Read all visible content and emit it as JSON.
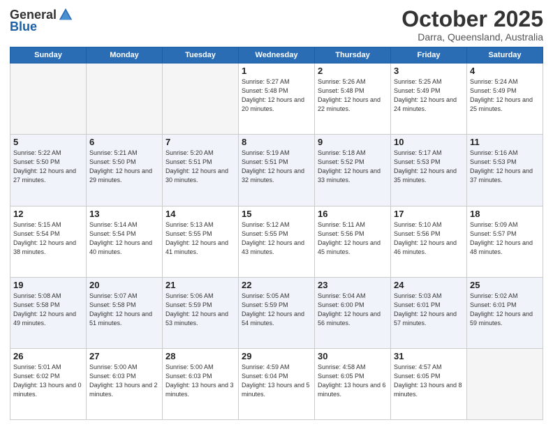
{
  "header": {
    "logo_general": "General",
    "logo_blue": "Blue",
    "month_title": "October 2025",
    "location": "Darra, Queensland, Australia"
  },
  "days_of_week": [
    "Sunday",
    "Monday",
    "Tuesday",
    "Wednesday",
    "Thursday",
    "Friday",
    "Saturday"
  ],
  "weeks": [
    [
      {
        "day": null,
        "info": null
      },
      {
        "day": null,
        "info": null
      },
      {
        "day": null,
        "info": null
      },
      {
        "day": "1",
        "info": "Sunrise: 5:27 AM\nSunset: 5:48 PM\nDaylight: 12 hours\nand 20 minutes."
      },
      {
        "day": "2",
        "info": "Sunrise: 5:26 AM\nSunset: 5:48 PM\nDaylight: 12 hours\nand 22 minutes."
      },
      {
        "day": "3",
        "info": "Sunrise: 5:25 AM\nSunset: 5:49 PM\nDaylight: 12 hours\nand 24 minutes."
      },
      {
        "day": "4",
        "info": "Sunrise: 5:24 AM\nSunset: 5:49 PM\nDaylight: 12 hours\nand 25 minutes."
      }
    ],
    [
      {
        "day": "5",
        "info": "Sunrise: 5:22 AM\nSunset: 5:50 PM\nDaylight: 12 hours\nand 27 minutes."
      },
      {
        "day": "6",
        "info": "Sunrise: 5:21 AM\nSunset: 5:50 PM\nDaylight: 12 hours\nand 29 minutes."
      },
      {
        "day": "7",
        "info": "Sunrise: 5:20 AM\nSunset: 5:51 PM\nDaylight: 12 hours\nand 30 minutes."
      },
      {
        "day": "8",
        "info": "Sunrise: 5:19 AM\nSunset: 5:51 PM\nDaylight: 12 hours\nand 32 minutes."
      },
      {
        "day": "9",
        "info": "Sunrise: 5:18 AM\nSunset: 5:52 PM\nDaylight: 12 hours\nand 33 minutes."
      },
      {
        "day": "10",
        "info": "Sunrise: 5:17 AM\nSunset: 5:53 PM\nDaylight: 12 hours\nand 35 minutes."
      },
      {
        "day": "11",
        "info": "Sunrise: 5:16 AM\nSunset: 5:53 PM\nDaylight: 12 hours\nand 37 minutes."
      }
    ],
    [
      {
        "day": "12",
        "info": "Sunrise: 5:15 AM\nSunset: 5:54 PM\nDaylight: 12 hours\nand 38 minutes."
      },
      {
        "day": "13",
        "info": "Sunrise: 5:14 AM\nSunset: 5:54 PM\nDaylight: 12 hours\nand 40 minutes."
      },
      {
        "day": "14",
        "info": "Sunrise: 5:13 AM\nSunset: 5:55 PM\nDaylight: 12 hours\nand 41 minutes."
      },
      {
        "day": "15",
        "info": "Sunrise: 5:12 AM\nSunset: 5:55 PM\nDaylight: 12 hours\nand 43 minutes."
      },
      {
        "day": "16",
        "info": "Sunrise: 5:11 AM\nSunset: 5:56 PM\nDaylight: 12 hours\nand 45 minutes."
      },
      {
        "day": "17",
        "info": "Sunrise: 5:10 AM\nSunset: 5:56 PM\nDaylight: 12 hours\nand 46 minutes."
      },
      {
        "day": "18",
        "info": "Sunrise: 5:09 AM\nSunset: 5:57 PM\nDaylight: 12 hours\nand 48 minutes."
      }
    ],
    [
      {
        "day": "19",
        "info": "Sunrise: 5:08 AM\nSunset: 5:58 PM\nDaylight: 12 hours\nand 49 minutes."
      },
      {
        "day": "20",
        "info": "Sunrise: 5:07 AM\nSunset: 5:58 PM\nDaylight: 12 hours\nand 51 minutes."
      },
      {
        "day": "21",
        "info": "Sunrise: 5:06 AM\nSunset: 5:59 PM\nDaylight: 12 hours\nand 53 minutes."
      },
      {
        "day": "22",
        "info": "Sunrise: 5:05 AM\nSunset: 5:59 PM\nDaylight: 12 hours\nand 54 minutes."
      },
      {
        "day": "23",
        "info": "Sunrise: 5:04 AM\nSunset: 6:00 PM\nDaylight: 12 hours\nand 56 minutes."
      },
      {
        "day": "24",
        "info": "Sunrise: 5:03 AM\nSunset: 6:01 PM\nDaylight: 12 hours\nand 57 minutes."
      },
      {
        "day": "25",
        "info": "Sunrise: 5:02 AM\nSunset: 6:01 PM\nDaylight: 12 hours\nand 59 minutes."
      }
    ],
    [
      {
        "day": "26",
        "info": "Sunrise: 5:01 AM\nSunset: 6:02 PM\nDaylight: 13 hours\nand 0 minutes."
      },
      {
        "day": "27",
        "info": "Sunrise: 5:00 AM\nSunset: 6:03 PM\nDaylight: 13 hours\nand 2 minutes."
      },
      {
        "day": "28",
        "info": "Sunrise: 5:00 AM\nSunset: 6:03 PM\nDaylight: 13 hours\nand 3 minutes."
      },
      {
        "day": "29",
        "info": "Sunrise: 4:59 AM\nSunset: 6:04 PM\nDaylight: 13 hours\nand 5 minutes."
      },
      {
        "day": "30",
        "info": "Sunrise: 4:58 AM\nSunset: 6:05 PM\nDaylight: 13 hours\nand 6 minutes."
      },
      {
        "day": "31",
        "info": "Sunrise: 4:57 AM\nSunset: 6:05 PM\nDaylight: 13 hours\nand 8 minutes."
      },
      {
        "day": null,
        "info": null
      }
    ]
  ]
}
